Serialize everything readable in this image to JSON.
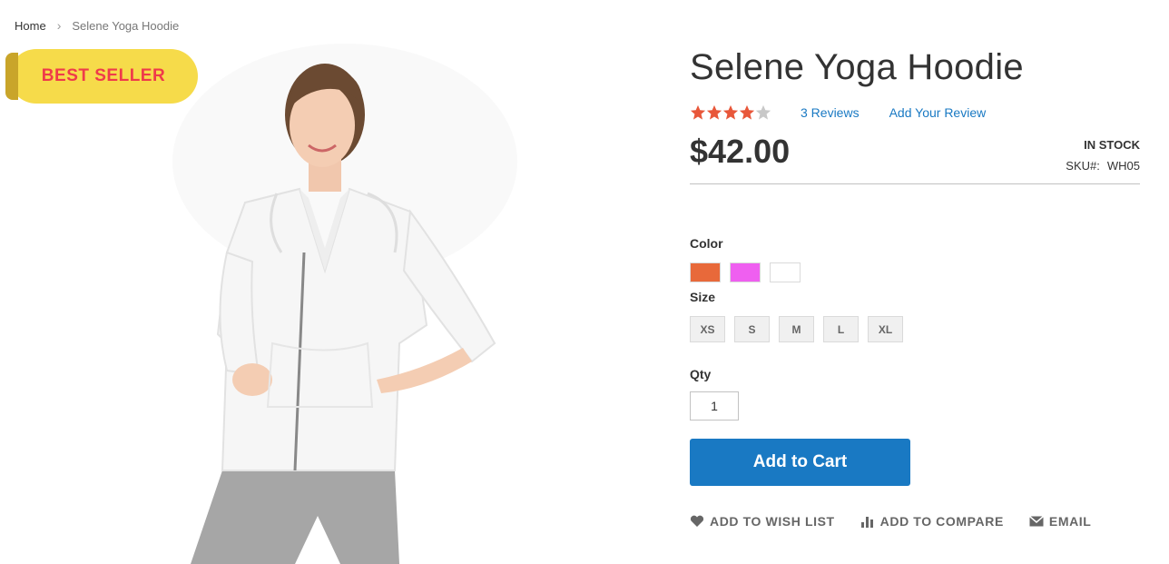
{
  "breadcrumb": {
    "home": "Home",
    "current": "Selene Yoga Hoodie"
  },
  "badge": {
    "text": "BEST SELLER"
  },
  "product": {
    "title": "Selene Yoga Hoodie",
    "rating_stars": 4,
    "reviews_link": "3 Reviews",
    "add_review_link": "Add Your Review",
    "price": "$42.00",
    "stock": "IN STOCK",
    "sku_label": "SKU#:",
    "sku_value": "WH05"
  },
  "options": {
    "color_label": "Color",
    "colors": [
      "#e8693a",
      "#ef5ff0",
      "#ffffff"
    ],
    "size_label": "Size",
    "sizes": [
      "XS",
      "S",
      "M",
      "L",
      "XL"
    ],
    "qty_label": "Qty",
    "qty_value": "1"
  },
  "buttons": {
    "add_to_cart": "Add to Cart"
  },
  "actions": {
    "wishlist": "ADD TO WISH LIST",
    "compare": "ADD TO COMPARE",
    "email": "EMAIL"
  },
  "colors": {
    "accent": "#1979c3",
    "star": "#e8573a",
    "badge_bg": "#f6db4a",
    "badge_text": "#ef3b4a"
  }
}
